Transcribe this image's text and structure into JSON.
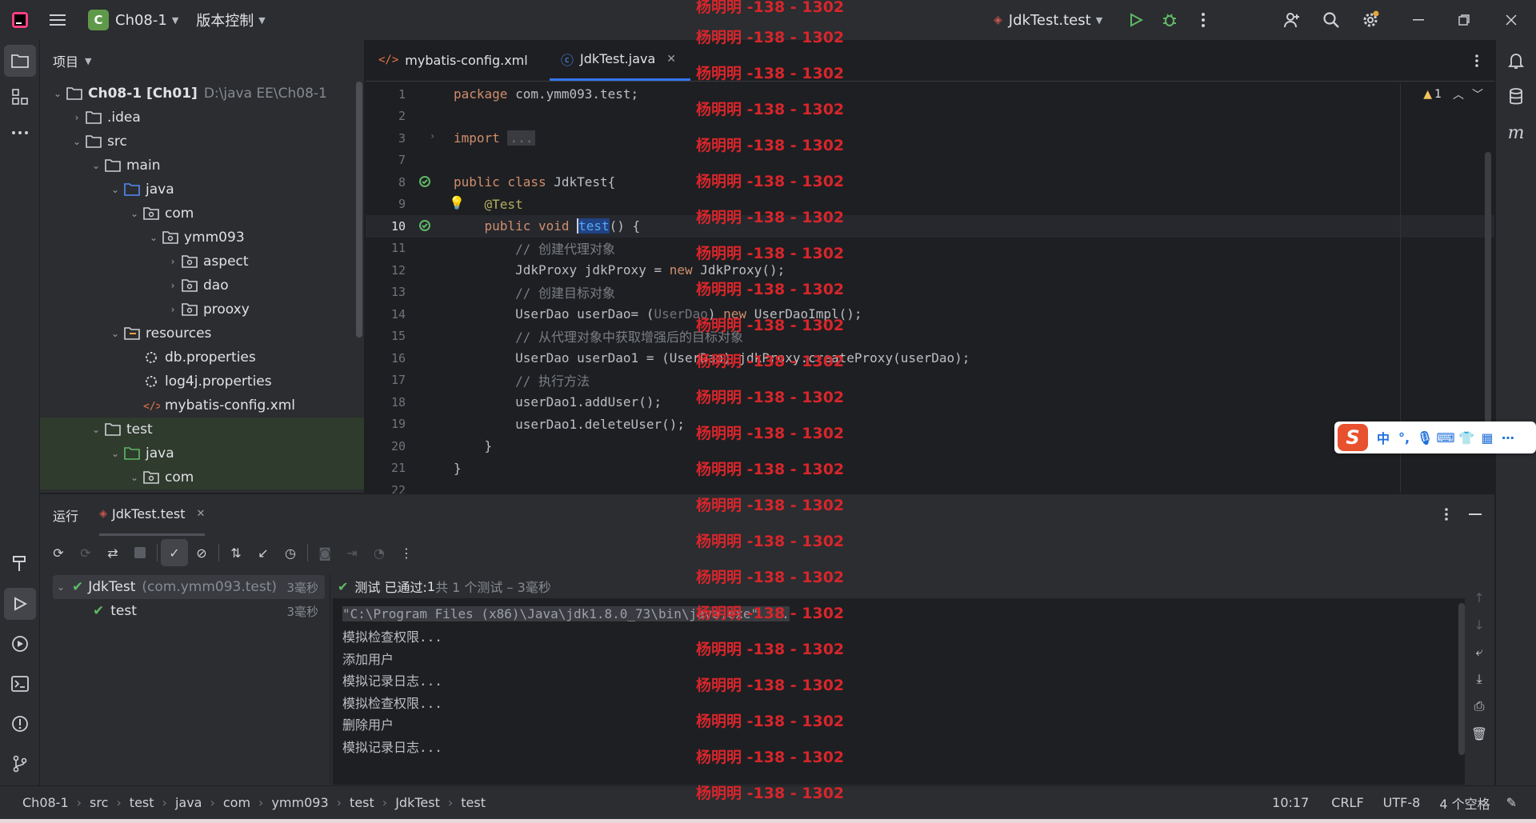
{
  "titlebar": {
    "project_badge": "C",
    "project_name": "Ch08-1",
    "vcs_label": "版本控制",
    "run_config": "JdkTest.test"
  },
  "project_panel": {
    "title": "项目",
    "tree": [
      {
        "label": "Ch08-1 [Ch01]",
        "suffix": "D:\\java EE\\Ch08-1",
        "depth": 0,
        "arrow": "open",
        "icon": "module"
      },
      {
        "label": ".idea",
        "depth": 1,
        "arrow": "closed",
        "icon": "folder"
      },
      {
        "label": "src",
        "depth": 1,
        "arrow": "open",
        "icon": "folder"
      },
      {
        "label": "main",
        "depth": 2,
        "arrow": "open",
        "icon": "folder"
      },
      {
        "label": "java",
        "depth": 3,
        "arrow": "open",
        "icon": "src-folder"
      },
      {
        "label": "com",
        "depth": 4,
        "arrow": "open",
        "icon": "package"
      },
      {
        "label": "ymm093",
        "depth": 5,
        "arrow": "open",
        "icon": "package"
      },
      {
        "label": "aspect",
        "depth": 6,
        "arrow": "closed",
        "icon": "package"
      },
      {
        "label": "dao",
        "depth": 6,
        "arrow": "closed",
        "icon": "package"
      },
      {
        "label": "prooxy",
        "depth": 6,
        "arrow": "closed",
        "icon": "package"
      },
      {
        "label": "resources",
        "depth": 3,
        "arrow": "open",
        "icon": "res-folder"
      },
      {
        "label": "db.properties",
        "depth": 4,
        "arrow": "none",
        "icon": "properties"
      },
      {
        "label": "log4j.properties",
        "depth": 4,
        "arrow": "none",
        "icon": "properties"
      },
      {
        "label": "mybatis-config.xml",
        "depth": 4,
        "arrow": "none",
        "icon": "xml"
      },
      {
        "label": "test",
        "depth": 2,
        "arrow": "open",
        "icon": "folder"
      },
      {
        "label": "java",
        "depth": 3,
        "arrow": "open",
        "icon": "test-folder"
      },
      {
        "label": "com",
        "depth": 4,
        "arrow": "open",
        "icon": "package"
      }
    ]
  },
  "editor": {
    "tabs": [
      {
        "label": "mybatis-config.xml",
        "icon": "xml"
      },
      {
        "label": "JdkTest.java",
        "icon": "class"
      }
    ],
    "warning_count": "1",
    "lines": [
      {
        "n": "1",
        "text": "package com.ymm093.test;"
      },
      {
        "n": "2",
        "text": ""
      },
      {
        "n": "3",
        "text": "import ..."
      },
      {
        "n": "7",
        "text": ""
      },
      {
        "n": "8",
        "text": "public class JdkTest{"
      },
      {
        "n": "9",
        "text": "    @Test"
      },
      {
        "n": "10",
        "text": "    public void test() {"
      },
      {
        "n": "11",
        "text": "        // 创建代理对象"
      },
      {
        "n": "12",
        "text": "        JdkProxy jdkProxy = new JdkProxy();"
      },
      {
        "n": "13",
        "text": "        // 创建目标对象"
      },
      {
        "n": "14",
        "text": "        UserDao userDao= (UserDao) new UserDaoImpl();"
      },
      {
        "n": "15",
        "text": "        // 从代理对象中获取增强后的目标对象"
      },
      {
        "n": "16",
        "text": "        UserDao userDao1 = (UserDao) jdkProxy.createProxy(userDao);"
      },
      {
        "n": "17",
        "text": "        // 执行方法"
      },
      {
        "n": "18",
        "text": "        userDao1.addUser();"
      },
      {
        "n": "19",
        "text": "        userDao1.deleteUser();"
      },
      {
        "n": "20",
        "text": "    }"
      },
      {
        "n": "21",
        "text": "}"
      },
      {
        "n": "22",
        "text": ""
      }
    ]
  },
  "run_panel": {
    "title": "运行",
    "tab": "JdkTest.test",
    "tree": [
      {
        "label": "JdkTest",
        "suffix": "(com.ymm093.test)",
        "time": "3毫秒"
      },
      {
        "label": "test",
        "suffix": "",
        "time": "3毫秒"
      }
    ],
    "status_prefix": "测试 已通过: ",
    "status_count": "1",
    "status_rest": "共 1 个测试 – 3毫秒",
    "console": [
      "\"C:\\Program Files (x86)\\Java\\jdk1.8.0_73\\bin\\java.exe\" ...",
      "模拟检查权限...",
      "添加用户",
      "模拟记录日志...",
      "模拟检查权限...",
      "删除用户",
      "模拟记录日志..."
    ]
  },
  "statusbar": {
    "breadcrumbs": [
      "Ch08-1",
      "src",
      "test",
      "java",
      "com",
      "ymm093",
      "test",
      "JdkTest",
      "test"
    ],
    "position": "10:17",
    "line_sep": "CRLF",
    "encoding": "UTF-8",
    "indent": "4 个空格"
  },
  "watermark": "杨明明 -138 - 1302",
  "ime": {
    "chinese": "中"
  },
  "colors": {
    "accent": "#3574f0",
    "pass": "#5fb865",
    "watermark": "#d6262b"
  }
}
